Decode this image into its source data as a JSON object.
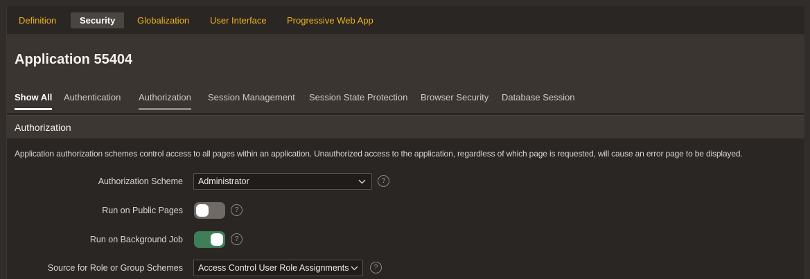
{
  "top_tabs": [
    {
      "label": "Definition",
      "active": false
    },
    {
      "label": "Security",
      "active": true
    },
    {
      "label": "Globalization",
      "active": false
    },
    {
      "label": "User Interface",
      "active": false
    },
    {
      "label": "Progressive Web App",
      "active": false
    }
  ],
  "header": {
    "title": "Application 55404"
  },
  "sub_tabs": [
    {
      "label": "Show All",
      "active": true
    },
    {
      "label": "Authentication",
      "active": false
    },
    {
      "label": "Authorization",
      "active": false
    },
    {
      "label": "Session Management",
      "active": false
    },
    {
      "label": "Session State Protection",
      "active": false
    },
    {
      "label": "Browser Security",
      "active": false
    },
    {
      "label": "Database Session",
      "active": false
    }
  ],
  "section": {
    "title": "Authorization",
    "description": "Application authorization schemes control access to all pages within an application. Unauthorized access to the application, regardless of which page is requested, will cause an error page to be displayed."
  },
  "fields": {
    "authorization_scheme": {
      "label": "Authorization Scheme",
      "value": "Administrator"
    },
    "run_on_public_pages": {
      "label": "Run on Public Pages",
      "on": false
    },
    "run_on_background_job": {
      "label": "Run on Background Job",
      "on": true
    },
    "source_for_role": {
      "label": "Source for Role or Group Schemes",
      "value": "Access Control User Role Assignments"
    }
  },
  "help_glyph": "?",
  "colors": {
    "accent_tab": "#f0b31c",
    "toggle_on": "#3f7f58",
    "toggle_off": "#6f6a66",
    "background": "#2a2623"
  },
  "icons": [
    "chevron-down-icon",
    "help-icon"
  ]
}
